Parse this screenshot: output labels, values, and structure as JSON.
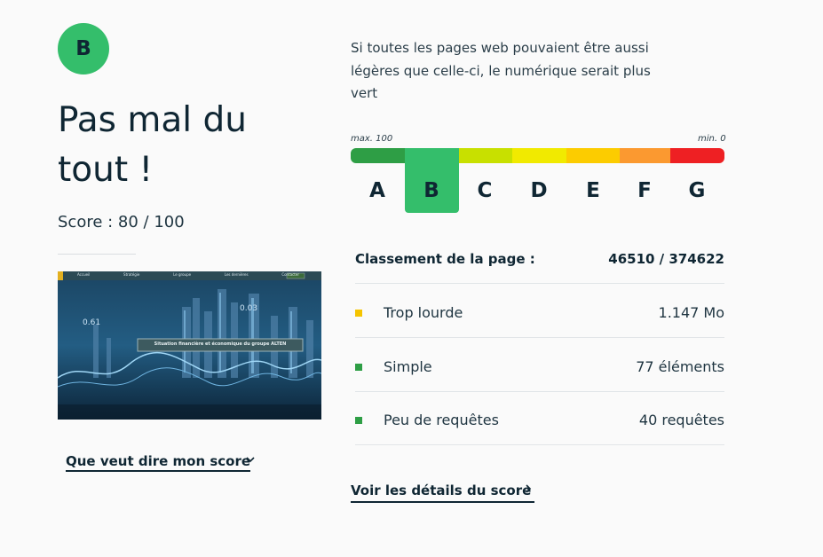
{
  "grade": {
    "letter": "B",
    "color": "#34be6b"
  },
  "verdict": "Pas mal du tout !",
  "score": {
    "text": "Score : 80 / 100",
    "value": 80,
    "max": 100
  },
  "thumbnail": {
    "nav_items": [
      "Accueil",
      "Stratégie",
      "Le groupe",
      "Les dernières",
      "Contacter"
    ],
    "banner_text": "Situation financière et économique du groupe ALTEN"
  },
  "score_link": "Que veut dire mon score",
  "intro": "Si toutes les pages web pouvaient être aussi légères que celle-ci, le numérique serait plus vert",
  "scale": {
    "max_label": "max. 100",
    "min_label": "min. 0",
    "active": "B",
    "grades": [
      {
        "letter": "A",
        "color": "#2e9e45"
      },
      {
        "letter": "B",
        "color": "#34be6b"
      },
      {
        "letter": "C",
        "color": "#c8e000"
      },
      {
        "letter": "D",
        "color": "#f1ea00"
      },
      {
        "letter": "E",
        "color": "#fccc00"
      },
      {
        "letter": "F",
        "color": "#fb9930"
      },
      {
        "letter": "G",
        "color": "#ee2023"
      }
    ]
  },
  "ranking": {
    "label": "Classement de la page :",
    "value": "46510 / 374622"
  },
  "metrics": [
    {
      "label": "Trop lourde",
      "value": "1.147 Mo",
      "color": "#f5c400"
    },
    {
      "label": "Simple",
      "value": "77 éléments",
      "color": "#2e9e45"
    },
    {
      "label": "Peu de requêtes",
      "value": "40 requêtes",
      "color": "#2e9e45"
    }
  ],
  "details_link": "Voir les détails du score"
}
